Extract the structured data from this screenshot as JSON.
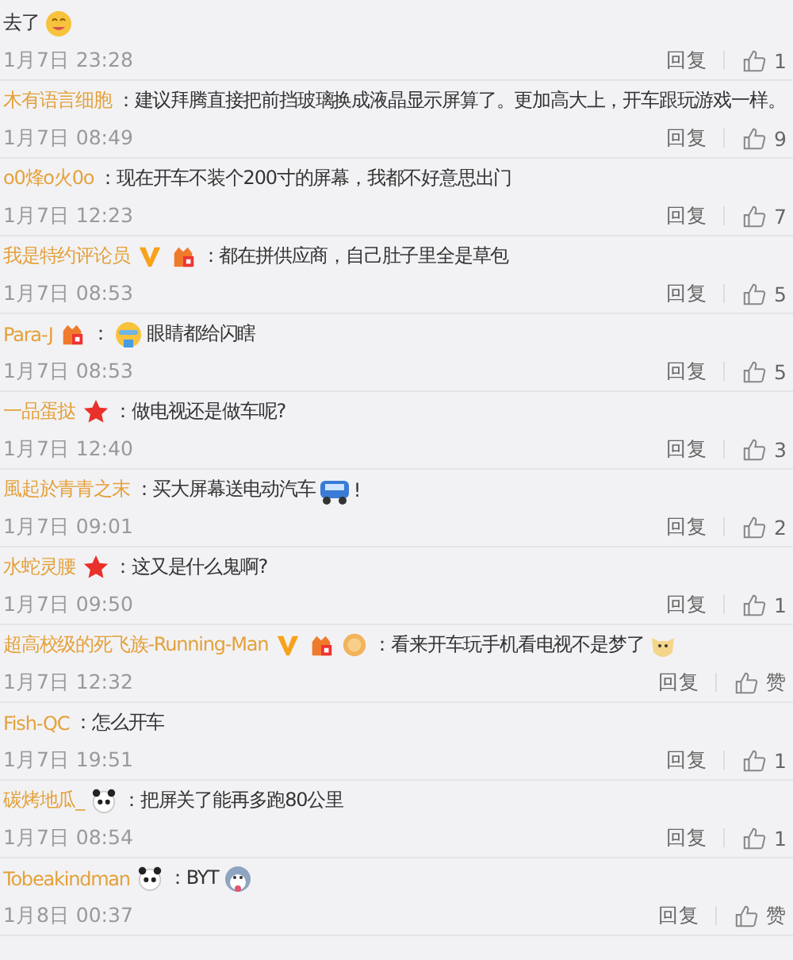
{
  "comments": [
    {
      "segments": [
        {
          "kind": "text",
          "text": "去了"
        },
        {
          "kind": "face-emoji"
        }
      ],
      "date": "1月7日 23:28",
      "reply": "回复",
      "likes": "1"
    },
    {
      "name": "木有语言细胞",
      "segments": [
        {
          "kind": "text",
          "text": "：建议拜腾直接把前挡玻璃换成液晶显示屏算了。更加高大上，开车跟玩游戏一样。"
        }
      ],
      "date": "1月7日 08:49",
      "reply": "回复",
      "likes": "9"
    },
    {
      "name": "o0烽o火0o",
      "segments": [
        {
          "kind": "text",
          "text": "：现在开车不装个200寸的屏幕，我都不好意思出门"
        }
      ],
      "date": "1月7日 12:23",
      "reply": "回复",
      "likes": "7"
    },
    {
      "name": "我是特约评论员",
      "badges": [
        {
          "kind": "verified"
        },
        {
          "kind": "level"
        }
      ],
      "segments": [
        {
          "kind": "text",
          "text": "：都在拼供应商，自己肚子里全是草包"
        }
      ],
      "date": "1月7日 08:53",
      "reply": "回复",
      "likes": "5"
    },
    {
      "name": "Para-J",
      "badges": [
        {
          "kind": "level"
        }
      ],
      "segments": [
        {
          "kind": "text",
          "text": "："
        },
        {
          "kind": "cry-emoji"
        },
        {
          "kind": "text",
          "text": "眼睛都给闪瞎"
        }
      ],
      "date": "1月7日 08:53",
      "reply": "回复",
      "likes": "5"
    },
    {
      "name": "一品蛋挞",
      "badges": [
        {
          "kind": "star"
        }
      ],
      "segments": [
        {
          "kind": "text",
          "text": "：做电视还是做车呢?"
        }
      ],
      "date": "1月7日 12:40",
      "reply": "回复",
      "likes": "3"
    },
    {
      "name": "風起於青青之末",
      "segments": [
        {
          "kind": "text",
          "text": "：买大屏幕送电动汽车"
        },
        {
          "kind": "car-emoji"
        },
        {
          "kind": "text",
          "text": "!"
        }
      ],
      "date": "1月7日 09:01",
      "reply": "回复",
      "likes": "2"
    },
    {
      "name": "水蛇灵腰",
      "badges": [
        {
          "kind": "star"
        }
      ],
      "segments": [
        {
          "kind": "text",
          "text": "：这又是什么鬼啊?"
        }
      ],
      "date": "1月7日 09:50",
      "reply": "回复",
      "likes": "1"
    },
    {
      "name": "超高校级的死飞族-Running-Man",
      "badges": [
        {
          "kind": "verified"
        },
        {
          "kind": "level"
        },
        {
          "kind": "medal"
        }
      ],
      "segments": [
        {
          "kind": "text",
          "text": "：看来开车玩手机看电视不是梦了"
        },
        {
          "kind": "dog-emoji"
        }
      ],
      "date": "1月7日 12:32",
      "reply": "回复",
      "likes": "赞"
    },
    {
      "name": "Fish-QC",
      "segments": [
        {
          "kind": "text",
          "text": "：怎么开车"
        }
      ],
      "date": "1月7日 19:51",
      "reply": "回复",
      "likes": "1"
    },
    {
      "name": "碳烤地瓜_",
      "badges": [
        {
          "kind": "panda"
        }
      ],
      "segments": [
        {
          "kind": "text",
          "text": "：把屏关了能再多跑80公里"
        }
      ],
      "date": "1月7日 08:54",
      "reply": "回复",
      "likes": "1"
    },
    {
      "name": "Tobeakindman",
      "badges": [
        {
          "kind": "panda"
        }
      ],
      "segments": [
        {
          "kind": "text",
          "text": "：BYT"
        },
        {
          "kind": "husky-emoji"
        }
      ],
      "date": "1月8日 00:37",
      "reply": "回复",
      "likes": "赞"
    }
  ]
}
